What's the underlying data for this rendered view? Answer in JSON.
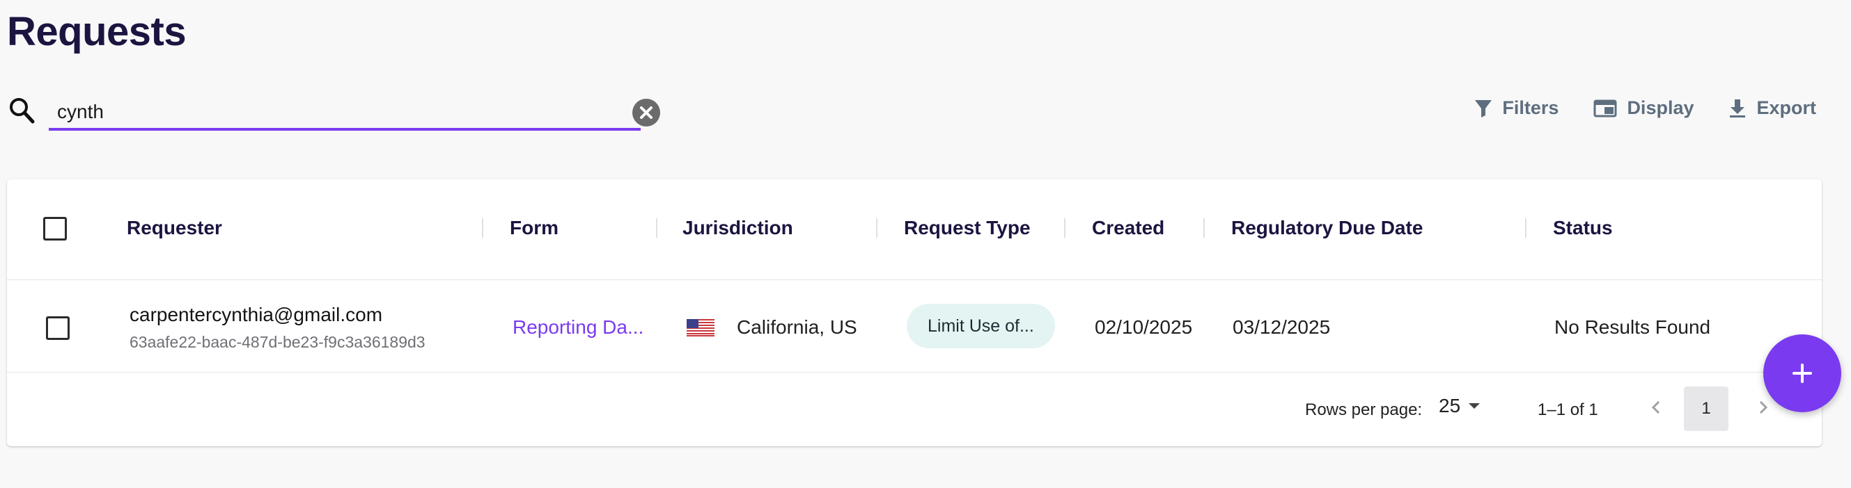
{
  "page": {
    "title": "Requests"
  },
  "search": {
    "value": "cynth",
    "placeholder": ""
  },
  "toolbar": {
    "filters_label": "Filters",
    "display_label": "Display",
    "export_label": "Export"
  },
  "table": {
    "columns": [
      "Requester",
      "Form",
      "Jurisdiction",
      "Request Type",
      "Created",
      "Regulatory Due Date",
      "Status"
    ],
    "rows": [
      {
        "requester_email": "carpentercynthia@gmail.com",
        "requester_id": "63aafe22-baac-487d-be23-f9c3a36189d3",
        "form": "Reporting Da...",
        "jurisdiction": "California, US",
        "jurisdiction_flag": "us-flag-icon",
        "request_type": "Limit Use of...",
        "created": "02/10/2025",
        "due_date": "03/12/2025",
        "status": "No Results Found"
      }
    ]
  },
  "pagination": {
    "rows_per_page_label": "Rows per page:",
    "rows_per_page_value": "25",
    "range": "1–1 of 1",
    "current_page": "1"
  },
  "colors": {
    "accent": "#7a3bf0",
    "title": "#1b1540",
    "chip_bg": "#e3f4f2",
    "toolbar_text": "#5e6e7e"
  },
  "icons": {
    "search": "search-icon",
    "clear": "clear-icon",
    "filters": "filter-icon",
    "display": "display-icon",
    "export": "download-icon",
    "add": "plus-icon"
  }
}
